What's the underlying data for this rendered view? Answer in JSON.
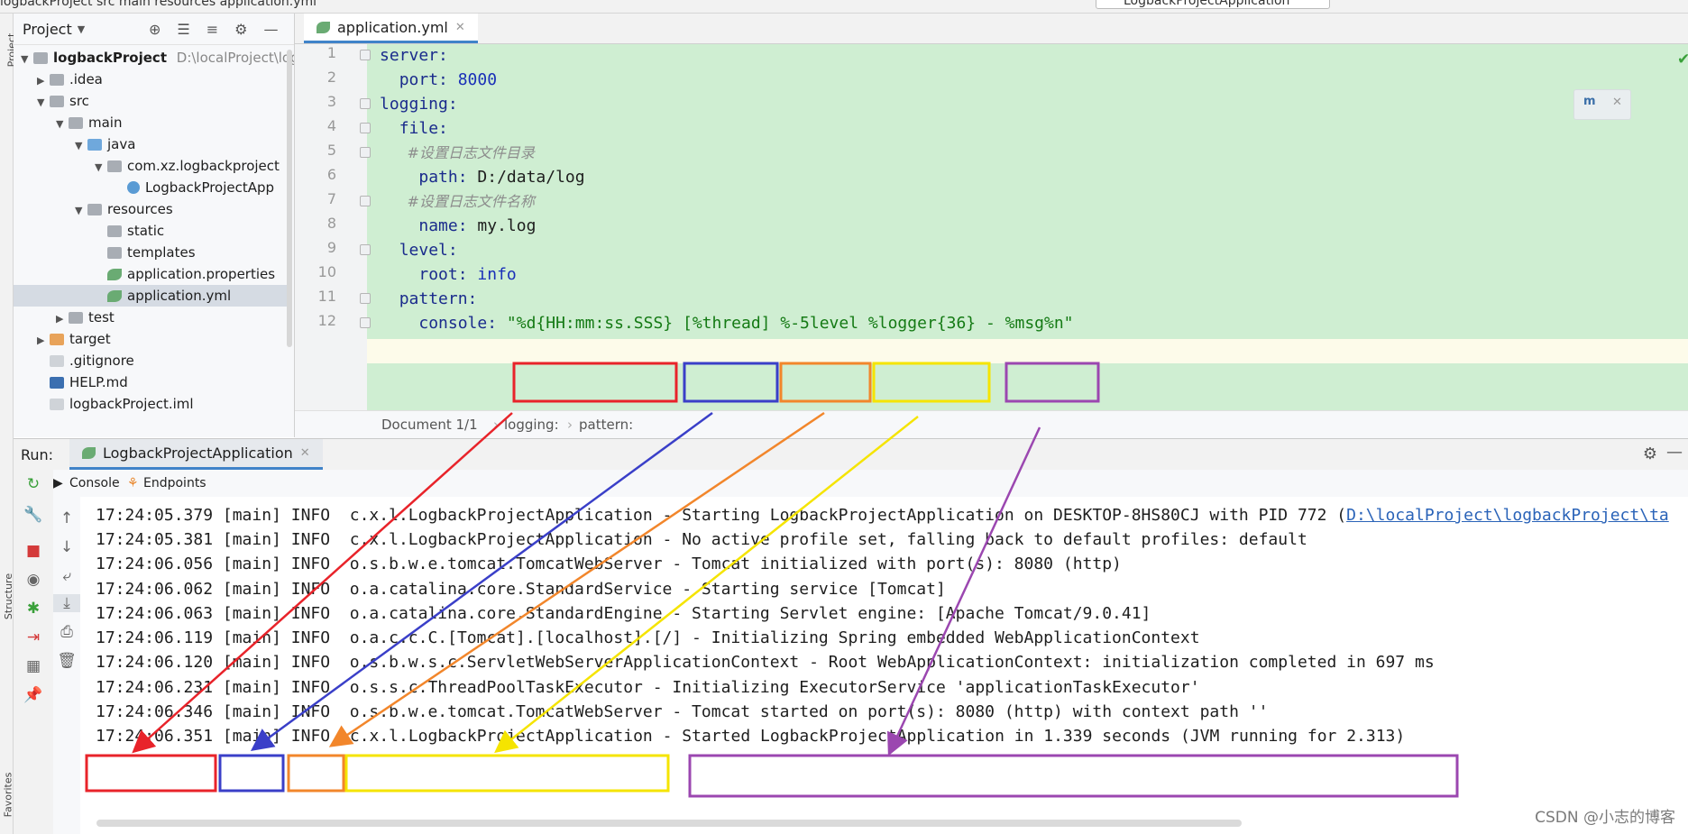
{
  "titlebar": {
    "crumbs": "logbackProject   src   main   resources   application.yml",
    "run_config": "LogbackProjectApplication"
  },
  "left_strip": {
    "project_label": "Project",
    "structure_label": "Structure",
    "favorites_label": "Favorites"
  },
  "project_panel": {
    "title": "Project",
    "items": [
      {
        "label": "logbackProject",
        "extra": "D:\\localProject\\log",
        "icon": "folder-icon"
      },
      {
        "label": ".idea",
        "icon": "folder-icon"
      },
      {
        "label": "src",
        "icon": "folder-icon"
      },
      {
        "label": "main",
        "icon": "folder-icon"
      },
      {
        "label": "java",
        "icon": "source-folder-icon"
      },
      {
        "label": "com.xz.logbackproject",
        "icon": "package-icon"
      },
      {
        "label": "LogbackProjectApp",
        "icon": "spring-class-icon"
      },
      {
        "label": "resources",
        "icon": "resources-folder-icon"
      },
      {
        "label": "static",
        "icon": "folder-icon"
      },
      {
        "label": "templates",
        "icon": "folder-icon"
      },
      {
        "label": "application.properties",
        "icon": "spring-config-icon"
      },
      {
        "label": "application.yml",
        "icon": "spring-config-icon"
      },
      {
        "label": "test",
        "icon": "folder-icon"
      },
      {
        "label": "target",
        "icon": "excluded-folder-icon"
      },
      {
        "label": ".gitignore",
        "icon": "file-icon"
      },
      {
        "label": "HELP.md",
        "icon": "markdown-icon"
      },
      {
        "label": "logbackProject.iml",
        "icon": "module-file-icon"
      }
    ]
  },
  "editor": {
    "tab_label": "application.yml",
    "lines": [
      {
        "n": "1"
      },
      {
        "n": "2"
      },
      {
        "n": "3"
      },
      {
        "n": "4"
      },
      {
        "n": "5"
      },
      {
        "n": "6"
      },
      {
        "n": "7"
      },
      {
        "n": "8"
      },
      {
        "n": "9"
      },
      {
        "n": "10"
      },
      {
        "n": "11"
      },
      {
        "n": "12"
      }
    ],
    "code": {
      "server": "server:",
      "port_key": "port: ",
      "port_val": "8000",
      "logging": "logging:",
      "file": "file:",
      "comment_dir": "#设置日志文件目录",
      "path_key": "path: ",
      "path_val": "D:/data/log",
      "comment_name": "#设置日志文件名称",
      "name_key": "name: ",
      "name_val": "my.log",
      "level": "level:",
      "root_key": "root: ",
      "root_val": "info",
      "pattern": "pattern:",
      "console_key": "console: ",
      "console_q1": "\"",
      "p_date": "%d{HH:mm:ss.SSS}",
      "p_thread": "[%thread]",
      "p_level": "%-5level",
      "p_logger": "%logger{36}",
      "p_dash": " - ",
      "p_msg": "%msg%n\""
    },
    "breadcrumb": {
      "doc": "Document 1/1",
      "b1": "logging:",
      "b2": "pattern:"
    }
  },
  "run_panel": {
    "label": "Run:",
    "tab_label": "LogbackProjectApplication",
    "console_tab": "Console",
    "endpoints_tab": "Endpoints"
  },
  "console": {
    "lines": [
      {
        "text": "17:24:05.379 [main] INFO  c.x.l.LogbackProjectApplication - Starting LogbackProjectApplication on DESKTOP-8HS80CJ with PID 772 (",
        "link": "D:\\localProject\\logbackProject\\ta"
      },
      {
        "text": "17:24:05.381 [main] INFO  c.x.l.LogbackProjectApplication - No active profile set, falling back to default profiles: default"
      },
      {
        "text": "17:24:06.056 [main] INFO  o.s.b.w.e.tomcat.TomcatWebServer - Tomcat initialized with port(s): 8080 (http)"
      },
      {
        "text": "17:24:06.062 [main] INFO  o.a.catalina.core.StandardService - Starting service [Tomcat]"
      },
      {
        "text": "17:24:06.063 [main] INFO  o.a.catalina.core.StandardEngine - Starting Servlet engine: [Apache Tomcat/9.0.41]"
      },
      {
        "text": "17:24:06.119 [main] INFO  o.a.c.c.C.[Tomcat].[localhost].[/] - Initializing Spring embedded WebApplicationContext"
      },
      {
        "text": "17:24:06.120 [main] INFO  o.s.b.w.s.c.ServletWebServerApplicationContext - Root WebApplicationContext: initialization completed in 697 ms"
      },
      {
        "text": "17:24:06.231 [main] INFO  o.s.s.c.ThreadPoolTaskExecutor - Initializing ExecutorService 'applicationTaskExecutor'"
      },
      {
        "text": "17:24:06.346 [main] INFO  o.s.b.w.e.tomcat.TomcatWebServer - Tomcat started on port(s): 8080 (http) with context path ''"
      }
    ],
    "last": {
      "time": "17:24:06.351",
      "thread": "[main]",
      "level": "INFO",
      "logger": "c.x.l.LogbackProjectApplication",
      "dash": "-",
      "msg": "Started LogbackProjectApplication in 1.339 seconds (JVM running for 2.313)"
    }
  },
  "watermark": "CSDN @小志的博客",
  "annotation_colors": {
    "date": "#e8232a",
    "thread": "#3a3fc8",
    "level": "#f2862b",
    "logger": "#f5e400",
    "msg": "#9b47b0"
  }
}
